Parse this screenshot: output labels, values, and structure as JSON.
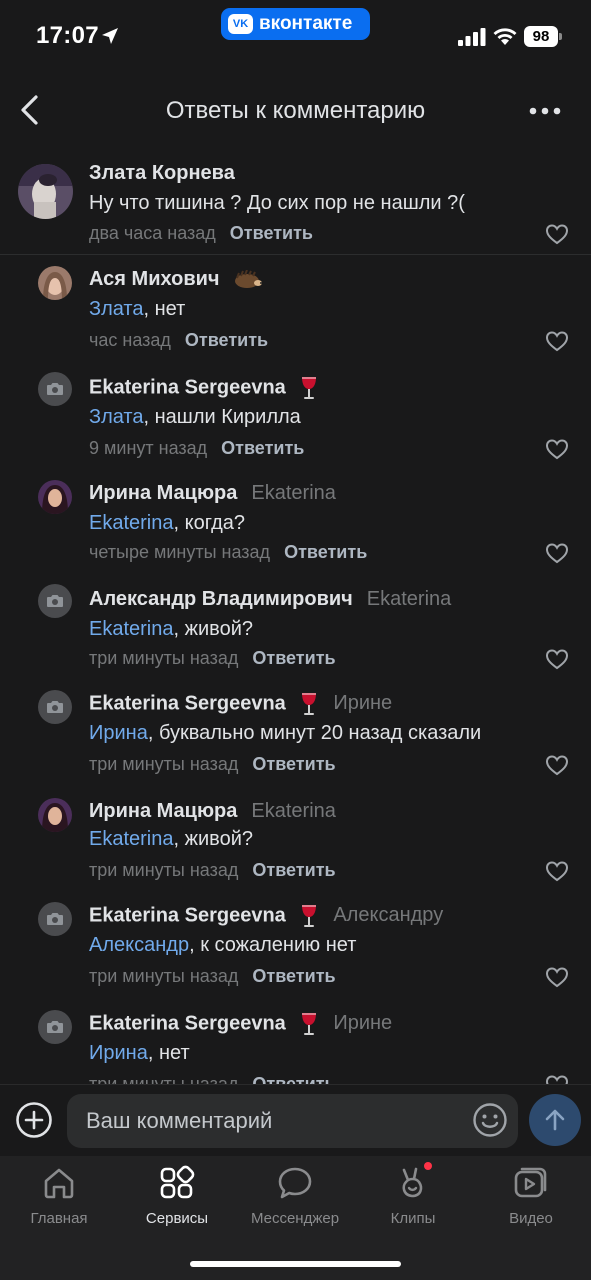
{
  "status_bar": {
    "time": "17:07",
    "vk_pill_text": "вконтакте",
    "vk_logo": "VK",
    "battery": "98"
  },
  "header": {
    "title": "Ответы к комментарию",
    "back_icon": "chevron-left-icon",
    "more_icon": "more-horizontal-icon"
  },
  "parent_comment": {
    "author": "Злата Корнева",
    "text": "Ну что тишина ? До сих пор не нашли ?(",
    "time": "два часа назад",
    "reply_label": "Ответить"
  },
  "replies": [
    {
      "author": "Ася Михович",
      "emoji": "hedgehog",
      "reply_to": "",
      "mention": "Злата",
      "text": ", нет",
      "time": "час назад",
      "reply_label": "Ответить",
      "avatar": "photo-girl"
    },
    {
      "author": "Ekaterina Sergeevna",
      "emoji": "wine",
      "reply_to": "",
      "mention": "Злата",
      "text": ", нашли Кирилла",
      "time": "9 минут назад",
      "reply_label": "Ответить",
      "avatar": "placeholder"
    },
    {
      "author": "Ирина Мацюра",
      "emoji": "",
      "reply_to": "Ekaterina",
      "mention": "Ekaterina",
      "text": ", когда?",
      "time": "четыре минуты назад",
      "reply_label": "Ответить",
      "avatar": "photo-woman"
    },
    {
      "author": "Александр Владимирович",
      "emoji": "",
      "reply_to": "Ekaterina",
      "mention": "Ekaterina",
      "text": ", живой?",
      "time": "три минуты назад",
      "reply_label": "Ответить",
      "avatar": "placeholder"
    },
    {
      "author": "Ekaterina Sergeevna",
      "emoji": "wine",
      "reply_to": "Ирине",
      "mention": "Ирина",
      "text": ", буквально минут 20 назад  сказали",
      "time": "три минуты назад",
      "reply_label": "Ответить",
      "avatar": "placeholder"
    },
    {
      "author": "Ирина Мацюра",
      "emoji": "",
      "reply_to": "Ekaterina",
      "mention": "Ekaterina",
      "text": ", живой?",
      "time": "три минуты назад",
      "reply_label": "Ответить",
      "avatar": "photo-woman"
    },
    {
      "author": "Ekaterina Sergeevna",
      "emoji": "wine",
      "reply_to": "Александру",
      "mention": "Александр",
      "text": ", к сожалению нет",
      "time": "три минуты назад",
      "reply_label": "Ответить",
      "avatar": "placeholder"
    },
    {
      "author": "Ekaterina Sergeevna",
      "emoji": "wine",
      "reply_to": "Ирине",
      "mention": "Ирина",
      "text": ", нет",
      "time": "три минуты назад",
      "reply_label": "Ответить",
      "avatar": "placeholder"
    }
  ],
  "composer": {
    "placeholder": "Ваш комментарий",
    "add_icon": "plus-circle-icon",
    "smile_icon": "smile-icon",
    "send_icon": "arrow-up-icon"
  },
  "tabs": [
    {
      "label": "Главная",
      "icon": "home-icon",
      "active": false
    },
    {
      "label": "Сервисы",
      "icon": "services-icon",
      "active": true
    },
    {
      "label": "Мессенджер",
      "icon": "message-icon",
      "active": false
    },
    {
      "label": "Клипы",
      "icon": "clips-icon",
      "active": false,
      "notification": true
    },
    {
      "label": "Видео",
      "icon": "video-icon",
      "active": false
    }
  ],
  "colors": {
    "background": "#19191a",
    "mention": "#71aaeb",
    "secondary": "#76787a",
    "accent": "#0a6ef0"
  }
}
